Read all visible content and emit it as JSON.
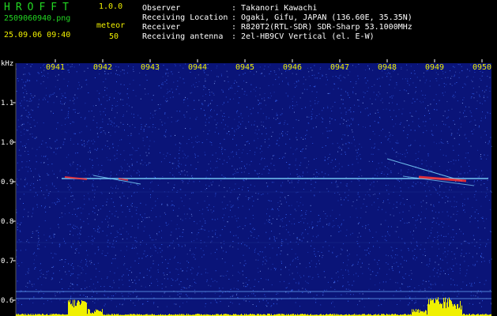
{
  "app": {
    "name": "HROFFT",
    "version": "1.0.0",
    "filename": "2509060940.png",
    "datetime": "25.09.06 09:40"
  },
  "meteor": {
    "label": "meteor",
    "count": "50"
  },
  "info": {
    "rows": [
      {
        "key": "Observer",
        "value": ": Takanori Kawachi"
      },
      {
        "key": "Receiving Location",
        "value": ": Ogaki, Gifu, JAPAN (136.60E, 35.35N)"
      },
      {
        "key": "Receiver",
        "value": ": R820T2(RTL-SDR) SDR-Sharp 53.1000MHz"
      },
      {
        "key": "Receiving antenna",
        "value": ": 2el-HB9CV Vertical (el. E-W)"
      }
    ]
  },
  "spectrogram": {
    "yunit": "kHz",
    "yticks": [
      "1.1",
      "1.0",
      "0.9",
      "0.8",
      "0.7",
      "0.6"
    ],
    "xticks": [
      "0941",
      "0942",
      "0943",
      "0944",
      "0945",
      "0946",
      "0947",
      "0948",
      "0949",
      "0950"
    ],
    "colors": {
      "background": "#0a1478",
      "noise": "#3a6cff",
      "trace": "#7fd8ff",
      "hot": "#ff3030",
      "bars": "#f0f000",
      "baseline": "#6fb4ff",
      "grid": "#1a2a8a",
      "axis": "#ffffff"
    }
  }
}
